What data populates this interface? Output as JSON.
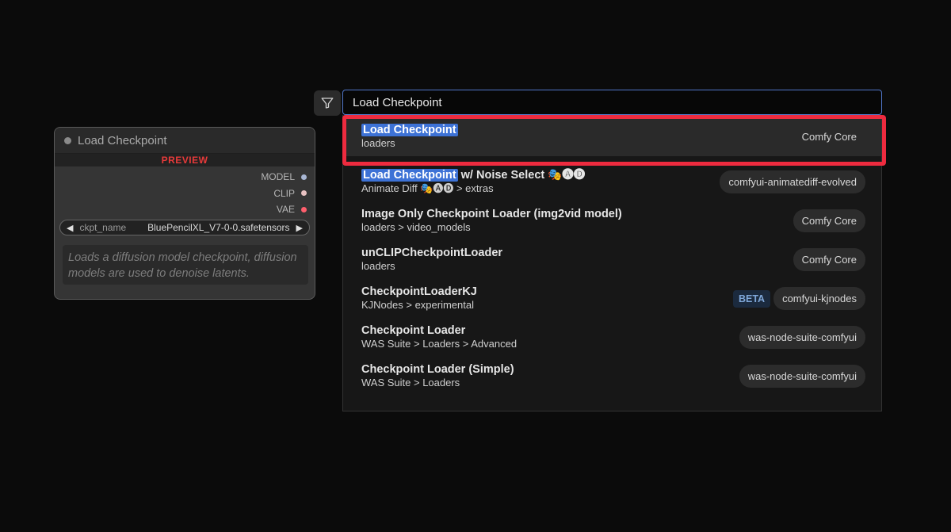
{
  "node": {
    "title": "Load Checkpoint",
    "preview_label": "PREVIEW",
    "outputs": [
      "MODEL",
      "CLIP",
      "VAE"
    ],
    "widget": {
      "name": "ckpt_name",
      "value": "BluePencilXL_V7-0-0.safetensors"
    },
    "description": "Loads a diffusion model checkpoint, diffusion models are used to denoise latents."
  },
  "search": {
    "value": "Load Checkpoint",
    "filter_icon": "filter-icon"
  },
  "results": [
    {
      "highlight": "Load Checkpoint",
      "rest": "",
      "category": "loaders",
      "beta": "",
      "source": "Comfy Core"
    },
    {
      "highlight": "Load Checkpoint",
      "rest": " w/ Noise Select 🎭🅐🅓",
      "category": "Animate Diff 🎭🅐🅓 > extras",
      "beta": "",
      "source": "comfyui-animatediff-evolved"
    },
    {
      "highlight": "",
      "rest": "Image Only Checkpoint Loader (img2vid model)",
      "category": "loaders > video_models",
      "beta": "",
      "source": "Comfy Core"
    },
    {
      "highlight": "",
      "rest": "unCLIPCheckpointLoader",
      "category": "loaders",
      "beta": "",
      "source": "Comfy Core"
    },
    {
      "highlight": "",
      "rest": "CheckpointLoaderKJ",
      "category": "KJNodes > experimental",
      "beta": "BETA",
      "source": "comfyui-kjnodes"
    },
    {
      "highlight": "",
      "rest": "Checkpoint Loader",
      "category": "WAS Suite > Loaders > Advanced",
      "beta": "",
      "source": "was-node-suite-comfyui"
    },
    {
      "highlight": "",
      "rest": "Checkpoint Loader (Simple)",
      "category": "WAS Suite > Loaders",
      "beta": "",
      "source": "was-node-suite-comfyui"
    }
  ]
}
